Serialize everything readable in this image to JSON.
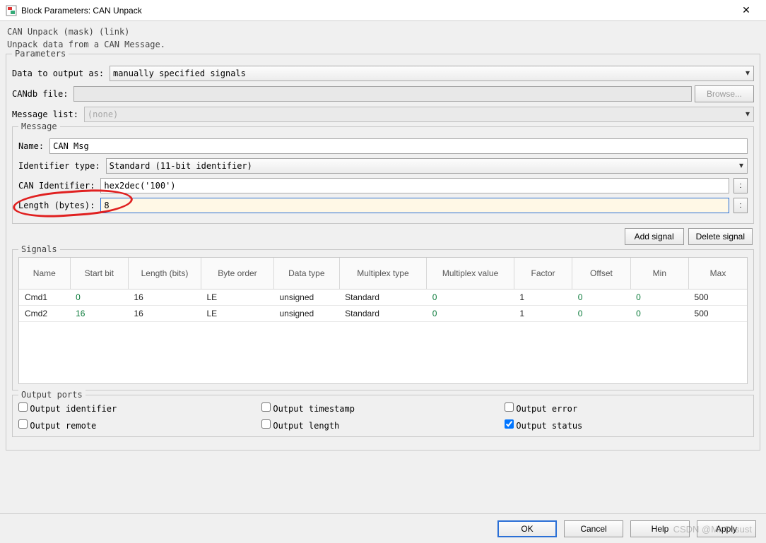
{
  "window": {
    "title": "Block Parameters: CAN Unpack",
    "close_icon": "✕"
  },
  "header": {
    "mask_line": "CAN Unpack (mask) (link)",
    "desc_line": "Unpack data from a CAN Message."
  },
  "parameters": {
    "legend": "Parameters",
    "data_to_output_label": "Data to output as:",
    "data_to_output_value": "manually specified signals",
    "candb_file_label": "CANdb file:",
    "candb_file_value": "",
    "browse_label": "Browse...",
    "message_list_label": "Message list:",
    "message_list_value": "(none)"
  },
  "message": {
    "legend": "Message",
    "name_label": "Name:",
    "name_value": "CAN Msg",
    "id_type_label": "Identifier type:",
    "id_type_value": "Standard (11-bit identifier)",
    "can_id_label": "CAN Identifier:",
    "can_id_value": "hex2dec('100')",
    "length_label": "Length (bytes):",
    "length_value": "8",
    "dots": ":"
  },
  "signal_buttons": {
    "add": "Add signal",
    "delete": "Delete signal"
  },
  "signals": {
    "legend": "Signals",
    "headers": [
      "Name",
      "Start bit",
      "Length (bits)",
      "Byte order",
      "Data type",
      "Multiplex type",
      "Multiplex value",
      "Factor",
      "Offset",
      "Min",
      "Max"
    ],
    "rows": [
      {
        "name": "Cmd1",
        "start": "0",
        "length": "16",
        "order": "LE",
        "dtype": "unsigned",
        "mtype": "Standard",
        "mvalue": "0",
        "factor": "1",
        "offset": "0",
        "min": "0",
        "max": "500"
      },
      {
        "name": "Cmd2",
        "start": "16",
        "length": "16",
        "order": "LE",
        "dtype": "unsigned",
        "mtype": "Standard",
        "mvalue": "0",
        "factor": "1",
        "offset": "0",
        "min": "0",
        "max": "500"
      }
    ]
  },
  "output_ports": {
    "legend": "Output ports",
    "identifier": "Output identifier",
    "remote": "Output remote",
    "timestamp": "Output timestamp",
    "length": "Output length",
    "error": "Output error",
    "status": "Output status"
  },
  "footer": {
    "ok": "OK",
    "cancel": "Cancel",
    "help": "Help",
    "apply": "Apply"
  },
  "watermark": "CSDN @Mr.Cssust"
}
